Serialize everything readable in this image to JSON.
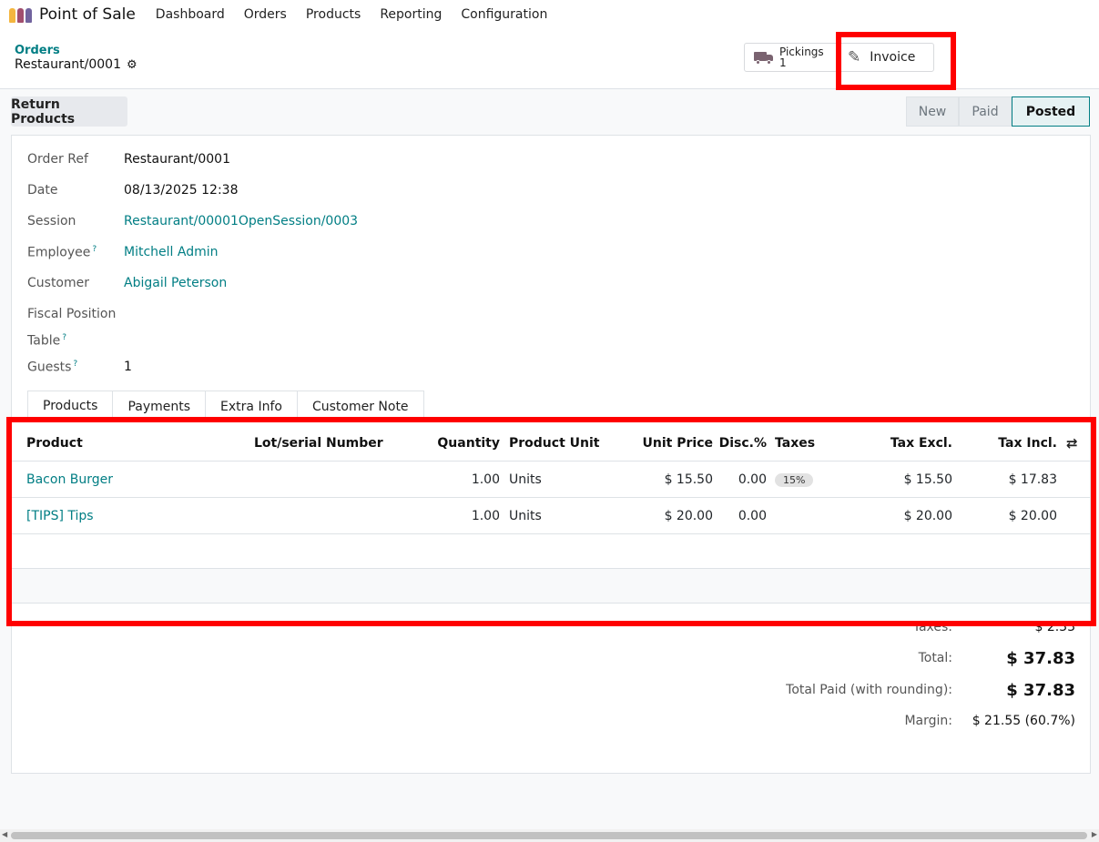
{
  "navbar": {
    "app_title": "Point of Sale",
    "items": [
      "Dashboard",
      "Orders",
      "Products",
      "Reporting",
      "Configuration"
    ],
    "icon_colors": [
      "#f4b63f",
      "#a14e6e",
      "#71639e"
    ]
  },
  "breadcrumb": {
    "parent": "Orders",
    "current": "Restaurant/0001"
  },
  "smart_buttons": {
    "pickings_label": "Pickings",
    "pickings_count": "1",
    "invoice_label": "Invoice"
  },
  "actions": {
    "return_products": "Return Products"
  },
  "statusbar": {
    "stages": [
      "New",
      "Paid",
      "Posted"
    ],
    "current": "Posted"
  },
  "fields": [
    {
      "label": "Order Ref",
      "value": "Restaurant/0001",
      "help": false,
      "link": false
    },
    {
      "label": "Date",
      "value": "08/13/2025 12:38",
      "help": false,
      "link": false
    },
    {
      "label": "Session",
      "value": "Restaurant/00001OpenSession/0003",
      "help": false,
      "link": true
    },
    {
      "label": "Employee",
      "value": "Mitchell Admin",
      "help": true,
      "link": true
    },
    {
      "label": "Customer",
      "value": "Abigail Peterson",
      "help": false,
      "link": true
    },
    {
      "label": "Fiscal Position",
      "value": "",
      "help": false,
      "link": false
    },
    {
      "label": "Table",
      "value": "",
      "help": true,
      "link": false
    },
    {
      "label": "Guests",
      "value": "1",
      "help": true,
      "link": false
    }
  ],
  "help_mark": "?",
  "tabs": [
    "Products",
    "Payments",
    "Extra Info",
    "Customer Note"
  ],
  "table": {
    "headers": {
      "product": "Product",
      "lot": "Lot/serial Number",
      "qty": "Quantity",
      "unit": "Product Unit",
      "price": "Unit Price",
      "disc": "Disc.%",
      "taxes": "Taxes",
      "excl": "Tax Excl.",
      "incl": "Tax Incl."
    },
    "rows": [
      {
        "product": "Bacon Burger",
        "lot": "",
        "qty": "1.00",
        "unit": "Units",
        "price": "$ 15.50",
        "disc": "0.00",
        "tax": "15%",
        "excl": "$ 15.50",
        "incl": "$ 17.83"
      },
      {
        "product": "[TIPS] Tips",
        "lot": "",
        "qty": "1.00",
        "unit": "Units",
        "price": "$ 20.00",
        "disc": "0.00",
        "tax": "",
        "excl": "$ 20.00",
        "incl": "$ 20.00"
      }
    ]
  },
  "totals": {
    "taxes_label": "Taxes:",
    "taxes_value": "$ 2.33",
    "total_label": "Total:",
    "total_value": "$ 37.83",
    "paid_label": "Total Paid (with rounding):",
    "paid_value": "$ 37.83",
    "margin_label": "Margin:",
    "margin_value": "$ 21.55 (60.7%)"
  },
  "highlight_color": "#ff0000",
  "accent_color": "#017e84"
}
